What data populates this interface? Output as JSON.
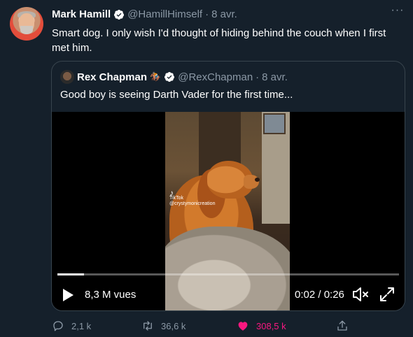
{
  "tweet": {
    "author_name": "Mark Hamill",
    "author_handle": "@HamillHimself",
    "separator": "·",
    "date": "8 avr.",
    "text": "Smart dog. I only wish I'd thought of hiding behind the couch when I first met him."
  },
  "quote": {
    "author_name": "Rex Chapman",
    "author_emoji": "🏇🏼",
    "author_handle": "@RexChapman",
    "separator": "·",
    "date": "8 avr.",
    "text": "Good boy is seeing Darth Vader for the first time...",
    "video": {
      "watermark_app": "TikTok",
      "watermark_user": "@crystymonicreation",
      "views": "8,3 M vues",
      "time": "0:02 / 0:26",
      "progress": 0.077
    }
  },
  "actions": {
    "replies": "2,1 k",
    "retweets": "36,6 k",
    "likes": "308,5 k"
  },
  "colors": {
    "background": "#15202b",
    "like_active": "#f91880",
    "verified": "#ffffff"
  }
}
